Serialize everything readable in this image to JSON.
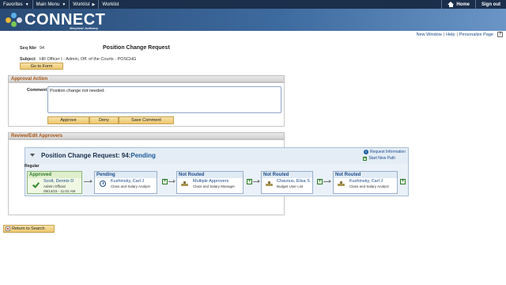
{
  "topnav": {
    "favorites": "Favorites",
    "main_menu": "Main Menu",
    "breadcrumb_1": "Worklist",
    "breadcrumb_2": "Worklist",
    "home": "Home",
    "signout": "Sign out"
  },
  "banner": {
    "logo_text": "CONNECT",
    "logo_sub": "Maryland Judiciary"
  },
  "util_links": {
    "new_window": "New Window",
    "help": "Help",
    "personalize": "Personalize Page",
    "sep": "|"
  },
  "request": {
    "seq_label": "Seq Nbr",
    "seq_value": "94",
    "title": "Position Change Request",
    "subject_label": "Subject",
    "subject_value": "HR Officer I - Admin, Off. of the Courts - POSCHG",
    "go_to_form": "Go to Form"
  },
  "approval_action": {
    "header": "Approval Action",
    "comment_label": "Comment",
    "comment_value": "Position change not needed.",
    "approve": "Approve",
    "deny": "Deny",
    "save_comment": "Save Comment"
  },
  "review": {
    "header": "Review/Edit Approvers",
    "path_title": "Position Change Request: 94:",
    "path_status": "Pending",
    "request_information": "Request Information",
    "start_new_path": "Start New Path",
    "regular_label": "Regular",
    "steps": [
      {
        "status": "Approved",
        "name": "Scott, Dennis D",
        "role": "Admin Official",
        "date": "09/14/15 - 11:02 AM"
      },
      {
        "status": "Pending",
        "name": "Kushinsky, Carl J",
        "role": "Class and Salary Analyst"
      },
      {
        "status": "Not Routed",
        "name": "Multiple Approvers",
        "role": "Class and Salary Manager"
      },
      {
        "status": "Not Routed",
        "name": "Chavous, Elisa S",
        "role": "Budget User List"
      },
      {
        "status": "Not Routed",
        "name": "Kushinsky, Carl J",
        "role": "Class and Salary Analyst"
      }
    ]
  },
  "return_to_search": "Return to Search",
  "colors": {
    "nav_bg": "#1b2f4b",
    "section_header_text": "#a8520f",
    "button_gold": "#edc66d",
    "approved_green": "#2a7a2a"
  }
}
